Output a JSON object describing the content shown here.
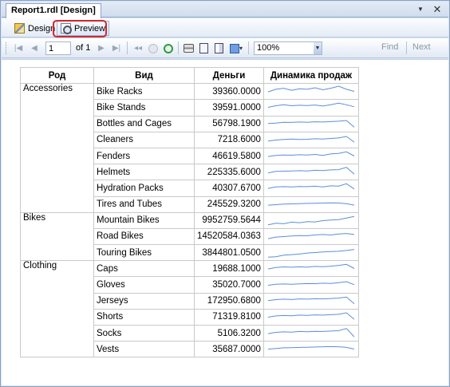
{
  "tab": {
    "title": "Report1.rdl [Design]"
  },
  "modes": {
    "design_label": "Design",
    "preview_label": "Preview"
  },
  "toolbar": {
    "page_value": "1",
    "of_label": "of 1",
    "zoom_value": "100%",
    "find_label": "Find",
    "next_label": "Next"
  },
  "report": {
    "headers": {
      "category": "Род",
      "product": "Вид",
      "money": "Деньги",
      "trend": "Динамика продаж"
    },
    "groups": [
      {
        "category": "Accessories",
        "rows": [
          {
            "product": "Bike Racks",
            "money": "39360.0000"
          },
          {
            "product": "Bike Stands",
            "money": "39591.0000"
          },
          {
            "product": "Bottles and Cages",
            "money": "56798.1900"
          },
          {
            "product": "Cleaners",
            "money": "7218.6000"
          },
          {
            "product": "Fenders",
            "money": "46619.5800"
          },
          {
            "product": "Helmets",
            "money": "225335.6000"
          },
          {
            "product": "Hydration Packs",
            "money": "40307.6700"
          },
          {
            "product": "Tires and Tubes",
            "money": "245529.3200"
          }
        ]
      },
      {
        "category": "Bikes",
        "rows": [
          {
            "product": "Mountain Bikes",
            "money": "9952759.5644"
          },
          {
            "product": "Road Bikes",
            "money": "14520584.0363"
          },
          {
            "product": "Touring Bikes",
            "money": "3844801.0500"
          }
        ]
      },
      {
        "category": "Clothing",
        "rows": [
          {
            "product": "Caps",
            "money": "19688.1000"
          },
          {
            "product": "Gloves",
            "money": "35020.7000"
          },
          {
            "product": "Jerseys",
            "money": "172950.6800"
          },
          {
            "product": "Shorts",
            "money": "71319.8100"
          },
          {
            "product": "Socks",
            "money": "5106.3200"
          },
          {
            "product": "Vests",
            "money": "35687.0000"
          }
        ]
      }
    ],
    "sparkline_color": "#5b8fd6",
    "sparklines": [
      [
        0.45,
        0.7,
        0.8,
        0.6,
        0.75,
        0.7,
        0.85,
        0.65,
        0.8,
        1.0,
        0.7,
        0.5
      ],
      [
        0.5,
        0.65,
        0.75,
        0.65,
        0.7,
        0.68,
        0.72,
        0.62,
        0.75,
        0.9,
        0.75,
        0.55
      ],
      [
        0.55,
        0.6,
        0.68,
        0.66,
        0.7,
        0.68,
        0.72,
        0.7,
        0.74,
        0.78,
        0.85,
        0.2
      ],
      [
        0.4,
        0.5,
        0.55,
        0.6,
        0.55,
        0.58,
        0.62,
        0.6,
        0.65,
        0.7,
        0.85,
        0.3
      ],
      [
        0.45,
        0.55,
        0.6,
        0.58,
        0.62,
        0.6,
        0.65,
        0.55,
        0.7,
        0.75,
        0.9,
        0.5
      ],
      [
        0.4,
        0.55,
        0.58,
        0.6,
        0.62,
        0.6,
        0.66,
        0.64,
        0.7,
        0.72,
        0.95,
        0.3
      ],
      [
        0.45,
        0.6,
        0.62,
        0.6,
        0.64,
        0.62,
        0.66,
        0.6,
        0.7,
        0.68,
        0.9,
        0.4
      ],
      [
        0.45,
        0.5,
        0.55,
        0.58,
        0.6,
        0.62,
        0.64,
        0.66,
        0.68,
        0.66,
        0.6,
        0.45
      ],
      [
        0.1,
        0.25,
        0.2,
        0.35,
        0.3,
        0.4,
        0.38,
        0.5,
        0.55,
        0.6,
        0.75,
        0.9
      ],
      [
        0.3,
        0.45,
        0.5,
        0.55,
        0.6,
        0.58,
        0.66,
        0.7,
        0.65,
        0.75,
        0.8,
        0.7
      ],
      [
        0.05,
        0.1,
        0.25,
        0.3,
        0.35,
        0.45,
        0.5,
        0.55,
        0.6,
        0.62,
        0.7,
        0.8
      ],
      [
        0.45,
        0.6,
        0.65,
        0.62,
        0.66,
        0.64,
        0.7,
        0.68,
        0.72,
        0.8,
        0.9,
        0.5
      ],
      [
        0.5,
        0.6,
        0.62,
        0.6,
        0.64,
        0.66,
        0.65,
        0.7,
        0.68,
        0.75,
        0.85,
        0.55
      ],
      [
        0.55,
        0.65,
        0.7,
        0.66,
        0.72,
        0.7,
        0.74,
        0.72,
        0.76,
        0.8,
        0.9,
        0.25
      ],
      [
        0.5,
        0.62,
        0.66,
        0.64,
        0.7,
        0.68,
        0.72,
        0.7,
        0.74,
        0.78,
        0.92,
        0.3
      ],
      [
        0.45,
        0.58,
        0.62,
        0.6,
        0.66,
        0.64,
        0.68,
        0.66,
        0.7,
        0.74,
        0.95,
        0.15
      ],
      [
        0.5,
        0.56,
        0.62,
        0.64,
        0.66,
        0.68,
        0.7,
        0.72,
        0.74,
        0.72,
        0.66,
        0.5
      ]
    ]
  }
}
